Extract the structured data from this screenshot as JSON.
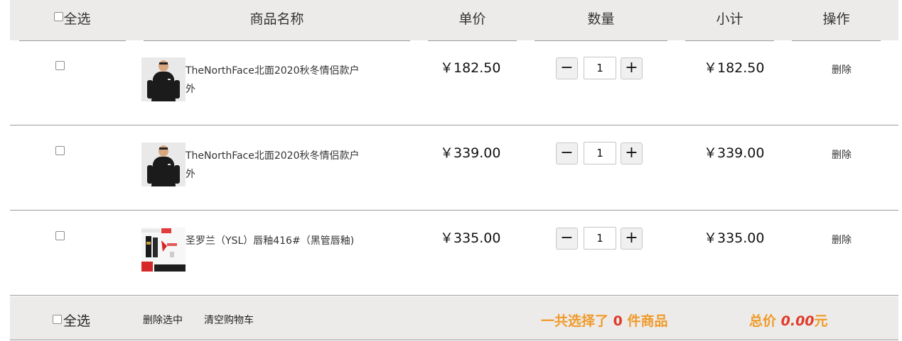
{
  "header": {
    "select_all": "全选",
    "product_name": "商品名称",
    "unit_price": "单价",
    "quantity": "数量",
    "subtotal": "小计",
    "actions": "操作"
  },
  "items": [
    {
      "name": "TheNorthFace北面2020秋冬情侣款户外",
      "price": "￥182.50",
      "qty": "1",
      "subtotal": "￥182.50",
      "delete": "删除",
      "thumb": "hoodie"
    },
    {
      "name": "TheNorthFace北面2020秋冬情侣款户外",
      "price": "￥339.00",
      "qty": "1",
      "subtotal": "￥339.00",
      "delete": "删除",
      "thumb": "hoodie"
    },
    {
      "name": "圣罗兰（YSL）唇釉416#（黑管唇釉)",
      "price": "￥335.00",
      "qty": "1",
      "subtotal": "￥335.00",
      "delete": "删除",
      "thumb": "lipstick"
    }
  ],
  "qty_minus": "−",
  "qty_plus": "+",
  "footer": {
    "select_all": "全选",
    "delete_selected": "删除选中",
    "clear_cart": "清空购物车",
    "count_prefix": "一共选择了",
    "count_value": "0",
    "count_suffix": "件商品",
    "total_prefix": "总价",
    "total_value": "0.00",
    "total_suffix": "元"
  },
  "colors": {
    "header_bg": "#ecebe9",
    "accent_orange": "#f09a2a",
    "accent_red": "#e03a2a",
    "divider": "#9c9c9c"
  }
}
